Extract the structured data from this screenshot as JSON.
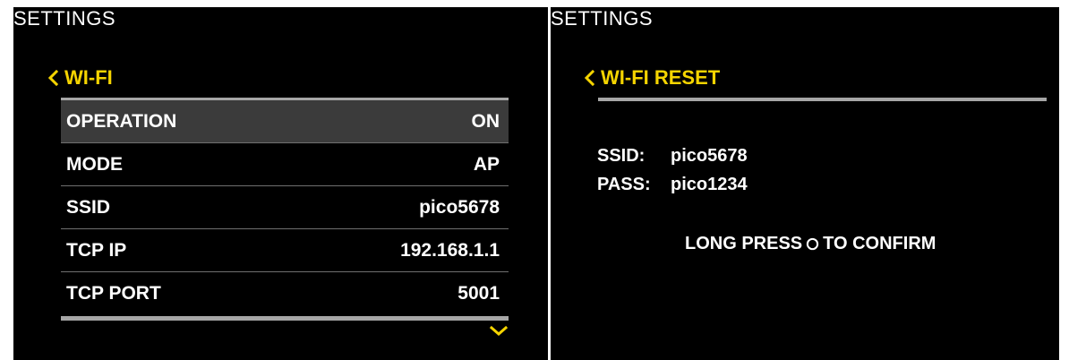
{
  "colors": {
    "accent": "#f5d400",
    "background": "#000000",
    "text": "#ffffff",
    "selected_row": "#3b3b3b",
    "divider": "#a6a6a6"
  },
  "left": {
    "header": "SETTINGS",
    "back_label": "WI-FI",
    "rows": [
      {
        "label": "OPERATION",
        "value": "ON"
      },
      {
        "label": "MODE",
        "value": "AP"
      },
      {
        "label": "SSID",
        "value": "pico5678"
      },
      {
        "label": "TCP IP",
        "value": "192.168.1.1"
      },
      {
        "label": "TCP PORT",
        "value": "5001"
      }
    ],
    "selected_index": 0,
    "icons": {
      "back": "chevron-left-icon",
      "scroll_down": "chevron-down-icon"
    }
  },
  "right": {
    "header": "SETTINGS",
    "back_label": "WI-FI RESET",
    "ssid_key": "SSID:",
    "ssid_value": "pico5678",
    "pass_key": "PASS:",
    "pass_value": "pico1234",
    "confirm_before": "LONG PRESS",
    "confirm_after": "TO CONFIRM",
    "icons": {
      "back": "chevron-left-icon",
      "button": "circle-button-icon"
    }
  }
}
